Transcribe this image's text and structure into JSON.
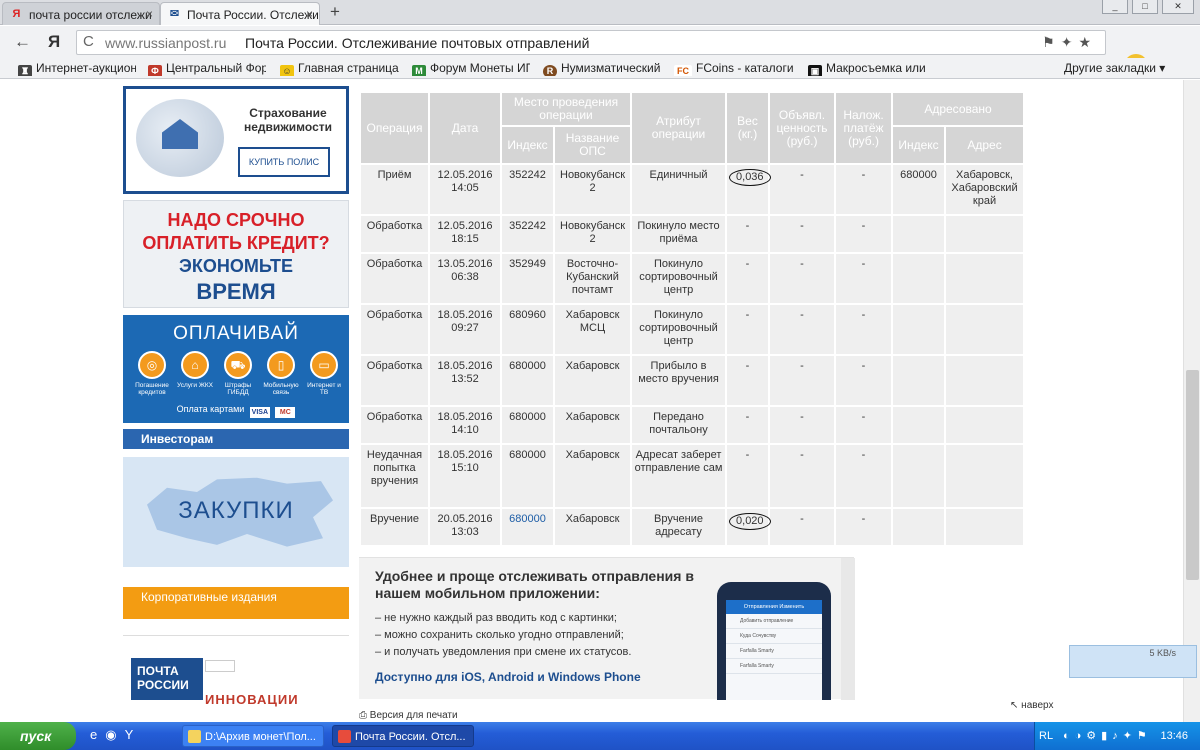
{
  "browser": {
    "tabs": [
      {
        "label": "почта россии отслежи",
        "favicon": "yandex-icon",
        "favicon_color": "#d22"
      },
      {
        "label": "Почта России. Отслежи",
        "favicon": "russian-post-icon",
        "favicon_color": "#1d4e8f"
      }
    ],
    "new_tab": "+",
    "window_buttons": {
      "minimize": "_",
      "maximize": "□",
      "close": "✕"
    },
    "nav": {
      "back": "←",
      "yandex": "Я"
    },
    "url": {
      "reload": "C",
      "host": "www.russianpost.ru",
      "title": "Почта России. Отслеживание почтовых отправлений",
      "icons": "⚑✦★"
    },
    "weather_badge": "24",
    "download": "⤓",
    "bookmarks": [
      {
        "label": "Интернет-аукцион",
        "icon_color": "#333",
        "icon": "♜"
      },
      {
        "label": "Центральный Фор",
        "icon_color": "#c0392b",
        "icon": "Ф"
      },
      {
        "label": "Главная страница",
        "icon_color": "#f1c40f",
        "icon": "☺"
      },
      {
        "label": "Форум Монеты ИП",
        "icon_color": "#2e8b3a",
        "icon": "M"
      },
      {
        "label": "Нумизматический",
        "icon_color": "#7f4b20",
        "icon": "R"
      },
      {
        "label": "FCoins - каталоги",
        "icon_color": "#d35400",
        "icon": "FC"
      },
      {
        "label": "Макросъемка или",
        "icon_color": "#111",
        "icon": "▣"
      }
    ],
    "other_bookmarks": "Другие закладки ▾"
  },
  "sidebar": {
    "insurance": {
      "title": "Страхование недвижимости",
      "button": "КУПИТЬ ПОЛИС"
    },
    "credit": {
      "line1": "НАДО СРОЧНО",
      "line2": "ОПЛАТИТЬ КРЕДИТ?",
      "line3": "ЭКОНОМЬТЕ",
      "line4": "ВРЕМЯ"
    },
    "pay": {
      "title": "ОПЛАЧИВАЙ",
      "items": [
        "Погашение кредитов",
        "Услуги ЖКХ",
        "Штрафы ГИБДД",
        "Мобильную связь",
        "Интернет и ТВ"
      ],
      "footer": "Оплата картами",
      "cards": [
        "VISA",
        "MC"
      ]
    },
    "investors": "Инвесторам",
    "zakupki": "ЗАКУПКИ",
    "corporate": "Корпоративные издания",
    "news_logo": "ПОЧТА РОССИИ",
    "news_title": "ИННОВАЦИИ"
  },
  "table": {
    "headers": {
      "operation": "Операция",
      "date": "Дата",
      "place": "Место проведения операции",
      "index": "Индекс",
      "ops_name": "Название ОПС",
      "attribute": "Атрибут операции",
      "weight": "Вес (кг.)",
      "declared": "Объявл. ценность (руб.)",
      "cod": "Налож. платёж (руб.)",
      "addressed": "Адресовано",
      "addr_index": "Индекс",
      "addr": "Адрес"
    },
    "rows": [
      {
        "op": "Приём",
        "date": "12.05.2016 14:05",
        "index": "352242",
        "ops": "Новокубанск 2",
        "attr": "Единичный",
        "weight": "0,036",
        "declared": "-",
        "cod": "-",
        "to_index": "680000",
        "to_addr": "Хабаровск, Хабаровский край"
      },
      {
        "op": "Обработка",
        "date": "12.05.2016 18:15",
        "index": "352242",
        "ops": "Новокубанск 2",
        "attr": "Покинуло место приёма",
        "weight": "-",
        "declared": "-",
        "cod": "-",
        "to_index": "",
        "to_addr": ""
      },
      {
        "op": "Обработка",
        "date": "13.05.2016 06:38",
        "index": "352949",
        "ops": "Восточно-Кубанский почтамт",
        "attr": "Покинуло сортировочный центр",
        "weight": "-",
        "declared": "-",
        "cod": "-",
        "to_index": "",
        "to_addr": ""
      },
      {
        "op": "Обработка",
        "date": "18.05.2016 09:27",
        "index": "680960",
        "ops": "Хабаровск МСЦ",
        "attr": "Покинуло сортировочный центр",
        "weight": "-",
        "declared": "-",
        "cod": "-",
        "to_index": "",
        "to_addr": ""
      },
      {
        "op": "Обработка",
        "date": "18.05.2016 13:52",
        "index": "680000",
        "ops": "Хабаровск",
        "attr": "Прибыло в место вручения",
        "weight": "-",
        "declared": "-",
        "cod": "-",
        "to_index": "",
        "to_addr": ""
      },
      {
        "op": "Обработка",
        "date": "18.05.2016 14:10",
        "index": "680000",
        "ops": "Хабаровск",
        "attr": "Передано почтальону",
        "weight": "-",
        "declared": "-",
        "cod": "-",
        "to_index": "",
        "to_addr": ""
      },
      {
        "op": "Неудачная попытка вручения",
        "date": "18.05.2016 15:10",
        "index": "680000",
        "ops": "Хабаровск",
        "attr": "Адресат заберет отправление сам",
        "weight": "-",
        "declared": "-",
        "cod": "-",
        "to_index": "",
        "to_addr": ""
      },
      {
        "op": "Вручение",
        "date": "20.05.2016 13:03",
        "index": "680000",
        "ops": "Хабаровск",
        "attr": "Вручение адресату",
        "weight": "0,020",
        "declared": "-",
        "cod": "-",
        "to_index": "",
        "to_addr": ""
      }
    ]
  },
  "promo": {
    "heading": "Удобнее и проще отслеживать отправления в нашем мобильном приложении:",
    "items": [
      "– не нужно каждый раз вводить код с картинки;",
      "– можно сохранить сколько угодно отправлений;",
      "– и получать уведомления при смене их статусов."
    ],
    "footer": "Доступно для iOS, Android и Windows Phone",
    "phone_tabs": "Отправления   Изменить",
    "phone_rows": [
      "Добавить отправление",
      "Куда Сочувству",
      "Farfalla Smarty",
      "Farfalla Smarty"
    ]
  },
  "print_link": "Версия для печати",
  "up_link": "наверх",
  "net_widget": "5 KB/s",
  "taskbar": {
    "start": "пуск",
    "tasks": [
      "D:\\Архив монет\\Пол...",
      "Почта России. Отсл..."
    ],
    "lang": "RL",
    "time": "13:46"
  }
}
